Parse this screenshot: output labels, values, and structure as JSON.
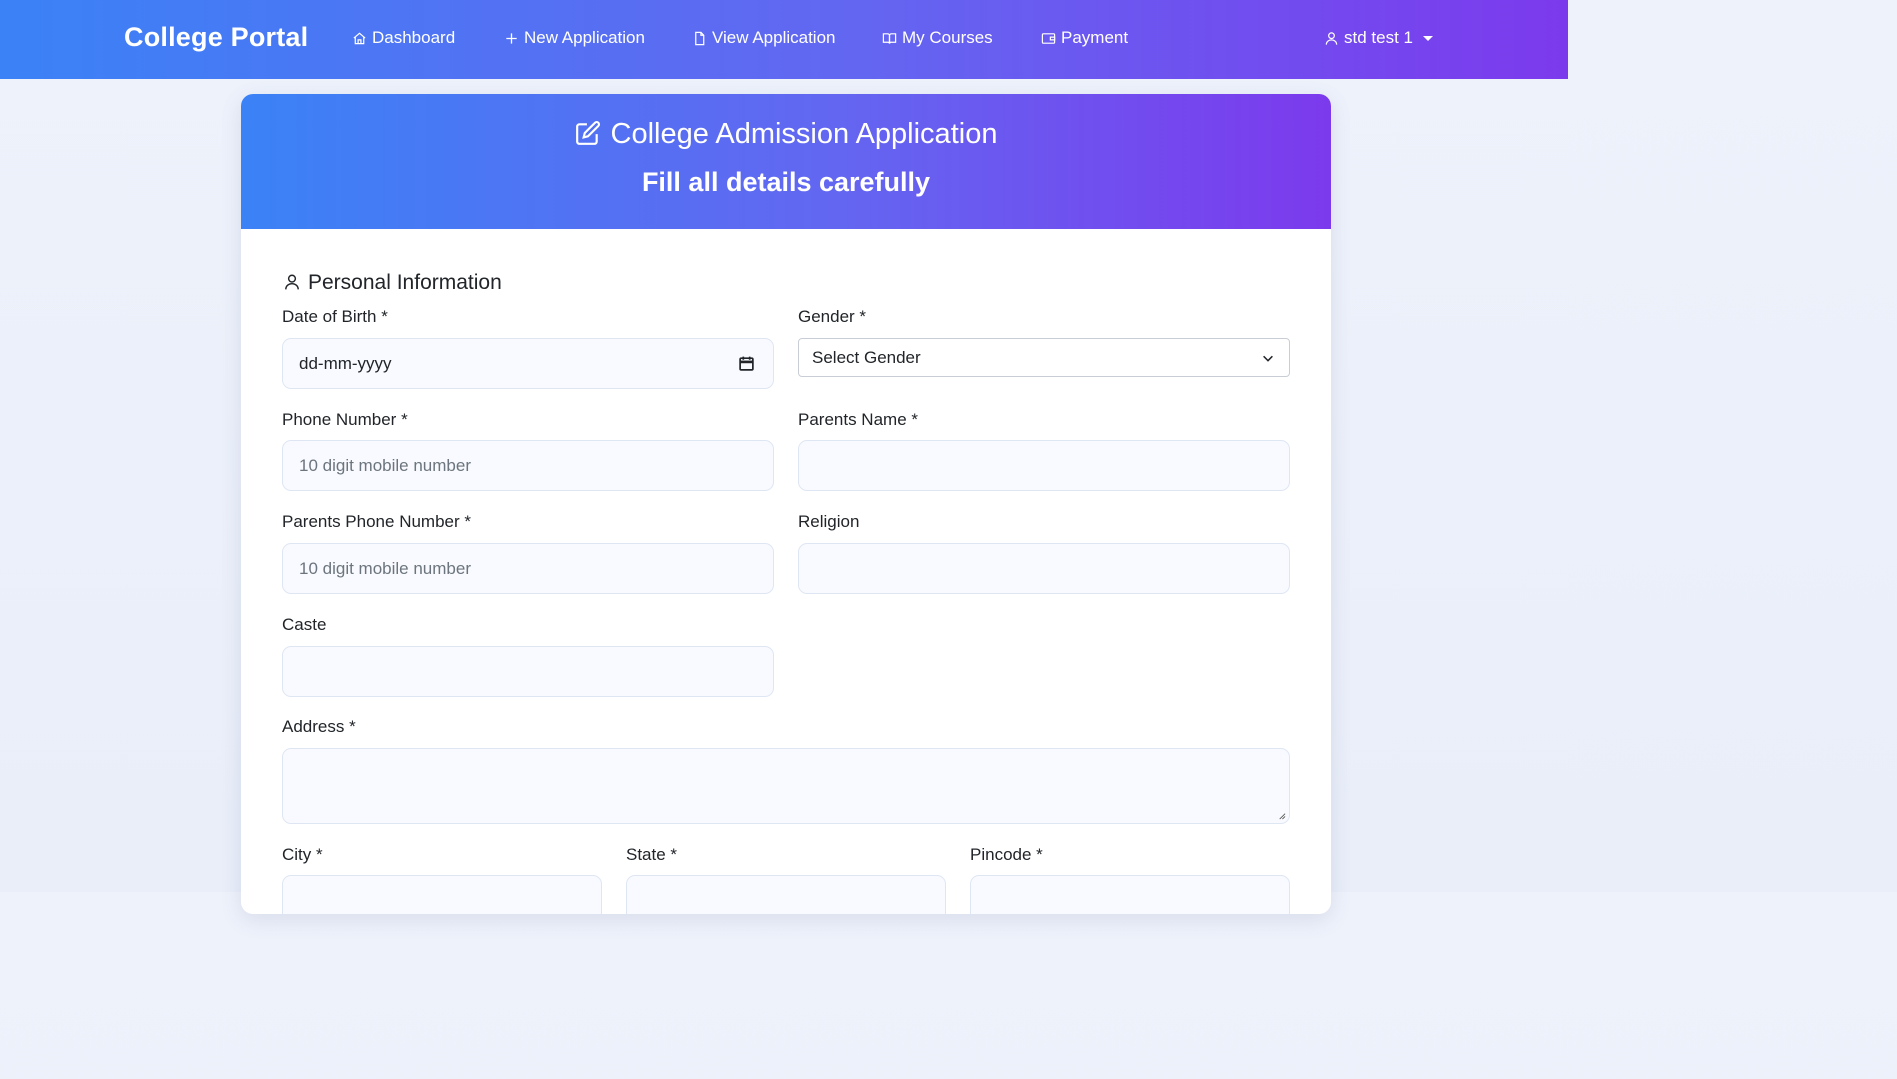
{
  "navbar": {
    "brand": "College Portal",
    "items": [
      {
        "label": "Dashboard",
        "icon": "home-icon"
      },
      {
        "label": "New Application",
        "icon": "plus-icon"
      },
      {
        "label": "View Application",
        "icon": "file-icon"
      },
      {
        "label": "My Courses",
        "icon": "book-icon"
      },
      {
        "label": "Payment",
        "icon": "wallet-icon"
      }
    ],
    "user": {
      "name": "std test 1",
      "icon": "user-icon"
    }
  },
  "header": {
    "title": "College Admission Application",
    "subtitle": "Fill all details carefully",
    "icon": "edit-icon"
  },
  "section": {
    "title": "Personal Information",
    "icon": "user-icon"
  },
  "form": {
    "dob": {
      "label": "Date of Birth *",
      "placeholder": "dd-mm-yyyy"
    },
    "gender": {
      "label": "Gender *",
      "value": "Select Gender"
    },
    "phone": {
      "label": "Phone Number *",
      "placeholder": "10 digit mobile number"
    },
    "parents_name": {
      "label": "Parents Name *",
      "value": ""
    },
    "parents_phone": {
      "label": "Parents Phone Number *",
      "placeholder": "10 digit mobile number"
    },
    "religion": {
      "label": "Religion",
      "value": ""
    },
    "caste": {
      "label": "Caste",
      "value": ""
    },
    "address": {
      "label": "Address *",
      "value": ""
    },
    "city": {
      "label": "City *",
      "value": ""
    },
    "state": {
      "label": "State *",
      "value": ""
    },
    "pincode": {
      "label": "Pincode *",
      "value": ""
    }
  },
  "colors": {
    "gradient_start": "#3b82f6",
    "gradient_end": "#7c3aed"
  }
}
